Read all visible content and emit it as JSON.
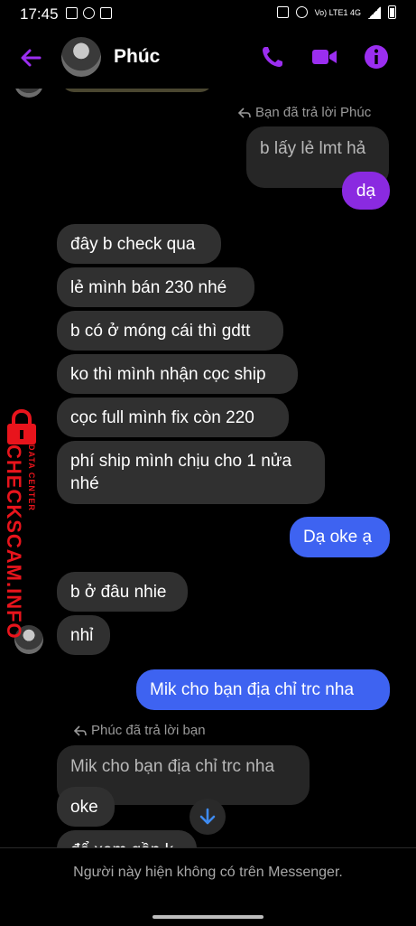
{
  "status_bar": {
    "time": "17:45",
    "network": "Vo) LTE1 4G"
  },
  "header": {
    "contact_name": "Phúc"
  },
  "colors": {
    "accent": "#9b2ef0",
    "sent_blue": "#3e63f1",
    "sent_purple": "#8a2ae0",
    "received": "#303030"
  },
  "messages": {
    "reply_label_1": "Bạn đã trả lời Phúc",
    "quoted_1": "b lấy lẻ lmt hả",
    "sent_1": "dạ",
    "recv_1": "đây b check qua",
    "recv_2": "lẻ mình bán 230 nhé",
    "recv_3": "b có ở móng cái thì gdtt",
    "recv_4": "ko thì mình nhận cọc ship",
    "recv_5": "cọc full mình fix còn 220",
    "recv_6_line1": "phí ship mình chịu cho 1 nửa",
    "recv_6_line2": "nhé",
    "sent_2": "Dạ oke ạ",
    "recv_7": "b ở đâu nhie",
    "recv_8": "nhỉ",
    "sent_3": "Mik cho bạn địa chỉ trc nha",
    "reply_label_2": "Phúc đã trả lời bạn",
    "quoted_2": "Mik cho bạn địa chỉ trc nha",
    "recv_9": "oke",
    "recv_10_partial": "để xem gần k"
  },
  "watermark": {
    "main": "CHECKSCAM.INFO",
    "sub": "DATA CENTER"
  },
  "footer": {
    "notice": "Người này hiện không có trên Messenger."
  }
}
